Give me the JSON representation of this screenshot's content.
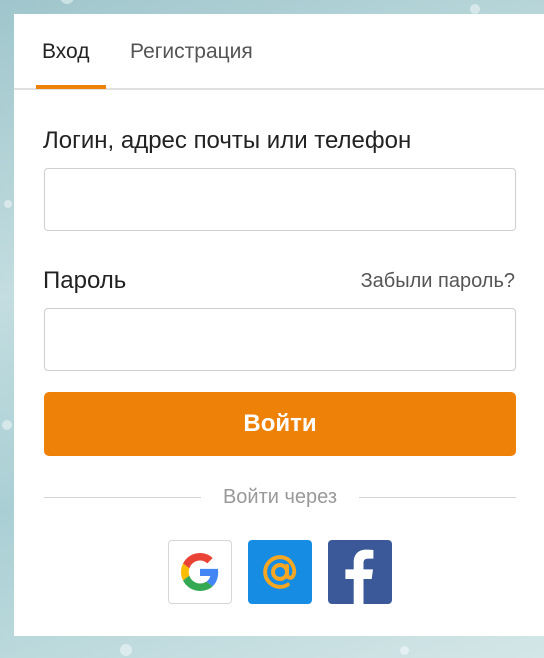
{
  "tabs": {
    "login": "Вход",
    "register": "Регистрация"
  },
  "form": {
    "login_label": "Логин, адрес почты или телефон",
    "login_value": "",
    "password_label": "Пароль",
    "password_value": "",
    "forgot_link": "Забыли пароль?",
    "submit_label": "Войти"
  },
  "social": {
    "divider_text": "Войти через",
    "providers": [
      {
        "icon": "google-icon",
        "color": "#ffffff"
      },
      {
        "icon": "mail-at-icon",
        "color": "#168de2"
      },
      {
        "icon": "facebook-icon",
        "color": "#3b5998"
      }
    ]
  },
  "colors": {
    "accent": "#ee8208",
    "text": "#222222",
    "muted": "#555555",
    "divider": "#999999"
  }
}
